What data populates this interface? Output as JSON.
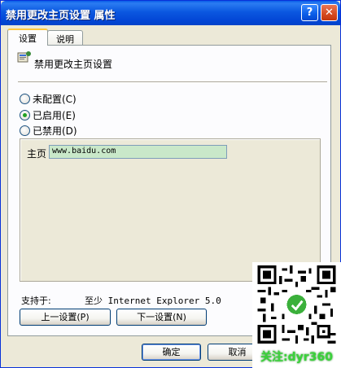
{
  "window": {
    "title": "禁用更改主页设置 属性",
    "help_glyph": "?",
    "close_glyph": "✕"
  },
  "tabs": [
    {
      "label": "设置",
      "active": true
    },
    {
      "label": "说明",
      "active": false
    }
  ],
  "policy": {
    "title": "禁用更改主页设置"
  },
  "radios": [
    {
      "label": "未配置(C)",
      "checked": false
    },
    {
      "label": "已启用(E)",
      "checked": true
    },
    {
      "label": "已禁用(D)",
      "checked": false
    }
  ],
  "homepage": {
    "label": "主页",
    "value": "www.baidu.com"
  },
  "supported": {
    "label": "支持于:",
    "value": "至少 Internet Explorer 5.0"
  },
  "buttons": {
    "prev": "上一设置(P)",
    "next": "下一设置(N)",
    "ok": "确定",
    "cancel": "取消"
  },
  "watermark": {
    "caption": "关注:dyr360",
    "qr_icon": "qr-code-icon"
  },
  "colors": {
    "titlebar": "#0a5de8",
    "homepage_field_bg": "#c9e8c9",
    "radio_checked": "#21a121",
    "watermark_text": "#3bd23b"
  }
}
